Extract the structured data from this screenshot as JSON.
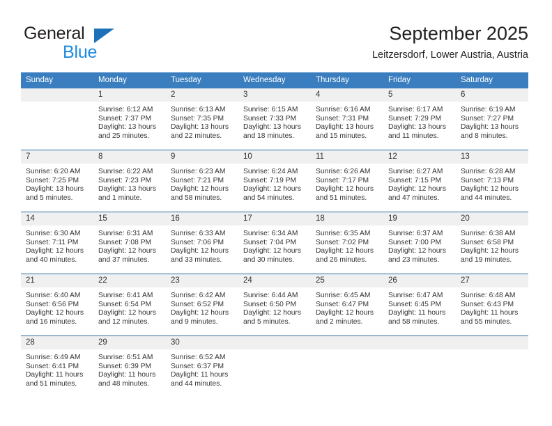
{
  "brand": {
    "name_top": "General",
    "name_bottom": "Blue",
    "triangle_color": "#1c71b8",
    "blue_color": "#1c8ae0",
    "dark_color": "#231f20"
  },
  "header": {
    "title": "September 2025",
    "subtitle": "Leitzersdorf, Lower Austria, Austria"
  },
  "theme": {
    "header_bg": "#3a7ebf",
    "header_text": "#ffffff",
    "row_rule": "#2b6ca3",
    "daynum_bg": "#f0f0f0",
    "body_text": "#333333"
  },
  "calendar": {
    "weekday_headers": [
      "Sunday",
      "Monday",
      "Tuesday",
      "Wednesday",
      "Thursday",
      "Friday",
      "Saturday"
    ],
    "weeks": [
      [
        {
          "day": "",
          "details": ""
        },
        {
          "day": "1",
          "details": "Sunrise: 6:12 AM\nSunset: 7:37 PM\nDaylight: 13 hours\nand 25 minutes."
        },
        {
          "day": "2",
          "details": "Sunrise: 6:13 AM\nSunset: 7:35 PM\nDaylight: 13 hours\nand 22 minutes."
        },
        {
          "day": "3",
          "details": "Sunrise: 6:15 AM\nSunset: 7:33 PM\nDaylight: 13 hours\nand 18 minutes."
        },
        {
          "day": "4",
          "details": "Sunrise: 6:16 AM\nSunset: 7:31 PM\nDaylight: 13 hours\nand 15 minutes."
        },
        {
          "day": "5",
          "details": "Sunrise: 6:17 AM\nSunset: 7:29 PM\nDaylight: 13 hours\nand 11 minutes."
        },
        {
          "day": "6",
          "details": "Sunrise: 6:19 AM\nSunset: 7:27 PM\nDaylight: 13 hours\nand 8 minutes."
        }
      ],
      [
        {
          "day": "7",
          "details": "Sunrise: 6:20 AM\nSunset: 7:25 PM\nDaylight: 13 hours\nand 5 minutes."
        },
        {
          "day": "8",
          "details": "Sunrise: 6:22 AM\nSunset: 7:23 PM\nDaylight: 13 hours\nand 1 minute."
        },
        {
          "day": "9",
          "details": "Sunrise: 6:23 AM\nSunset: 7:21 PM\nDaylight: 12 hours\nand 58 minutes."
        },
        {
          "day": "10",
          "details": "Sunrise: 6:24 AM\nSunset: 7:19 PM\nDaylight: 12 hours\nand 54 minutes."
        },
        {
          "day": "11",
          "details": "Sunrise: 6:26 AM\nSunset: 7:17 PM\nDaylight: 12 hours\nand 51 minutes."
        },
        {
          "day": "12",
          "details": "Sunrise: 6:27 AM\nSunset: 7:15 PM\nDaylight: 12 hours\nand 47 minutes."
        },
        {
          "day": "13",
          "details": "Sunrise: 6:28 AM\nSunset: 7:13 PM\nDaylight: 12 hours\nand 44 minutes."
        }
      ],
      [
        {
          "day": "14",
          "details": "Sunrise: 6:30 AM\nSunset: 7:11 PM\nDaylight: 12 hours\nand 40 minutes."
        },
        {
          "day": "15",
          "details": "Sunrise: 6:31 AM\nSunset: 7:08 PM\nDaylight: 12 hours\nand 37 minutes."
        },
        {
          "day": "16",
          "details": "Sunrise: 6:33 AM\nSunset: 7:06 PM\nDaylight: 12 hours\nand 33 minutes."
        },
        {
          "day": "17",
          "details": "Sunrise: 6:34 AM\nSunset: 7:04 PM\nDaylight: 12 hours\nand 30 minutes."
        },
        {
          "day": "18",
          "details": "Sunrise: 6:35 AM\nSunset: 7:02 PM\nDaylight: 12 hours\nand 26 minutes."
        },
        {
          "day": "19",
          "details": "Sunrise: 6:37 AM\nSunset: 7:00 PM\nDaylight: 12 hours\nand 23 minutes."
        },
        {
          "day": "20",
          "details": "Sunrise: 6:38 AM\nSunset: 6:58 PM\nDaylight: 12 hours\nand 19 minutes."
        }
      ],
      [
        {
          "day": "21",
          "details": "Sunrise: 6:40 AM\nSunset: 6:56 PM\nDaylight: 12 hours\nand 16 minutes."
        },
        {
          "day": "22",
          "details": "Sunrise: 6:41 AM\nSunset: 6:54 PM\nDaylight: 12 hours\nand 12 minutes."
        },
        {
          "day": "23",
          "details": "Sunrise: 6:42 AM\nSunset: 6:52 PM\nDaylight: 12 hours\nand 9 minutes."
        },
        {
          "day": "24",
          "details": "Sunrise: 6:44 AM\nSunset: 6:50 PM\nDaylight: 12 hours\nand 5 minutes."
        },
        {
          "day": "25",
          "details": "Sunrise: 6:45 AM\nSunset: 6:47 PM\nDaylight: 12 hours\nand 2 minutes."
        },
        {
          "day": "26",
          "details": "Sunrise: 6:47 AM\nSunset: 6:45 PM\nDaylight: 11 hours\nand 58 minutes."
        },
        {
          "day": "27",
          "details": "Sunrise: 6:48 AM\nSunset: 6:43 PM\nDaylight: 11 hours\nand 55 minutes."
        }
      ],
      [
        {
          "day": "28",
          "details": "Sunrise: 6:49 AM\nSunset: 6:41 PM\nDaylight: 11 hours\nand 51 minutes."
        },
        {
          "day": "29",
          "details": "Sunrise: 6:51 AM\nSunset: 6:39 PM\nDaylight: 11 hours\nand 48 minutes."
        },
        {
          "day": "30",
          "details": "Sunrise: 6:52 AM\nSunset: 6:37 PM\nDaylight: 11 hours\nand 44 minutes."
        },
        {
          "day": "",
          "details": ""
        },
        {
          "day": "",
          "details": ""
        },
        {
          "day": "",
          "details": ""
        },
        {
          "day": "",
          "details": ""
        }
      ]
    ]
  }
}
